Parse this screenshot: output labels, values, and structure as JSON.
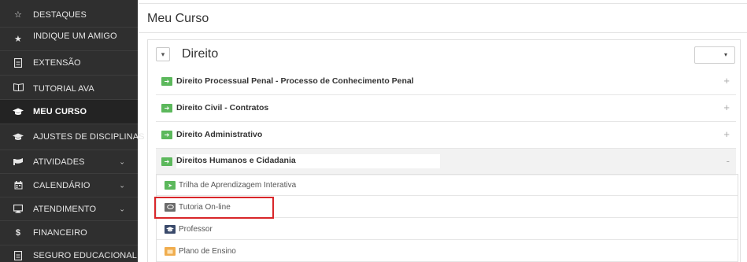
{
  "sidebar": {
    "items": [
      {
        "label": "DESTAQUES",
        "icon": "star-outline-icon"
      },
      {
        "label": "INDIQUE UM AMIGO",
        "icon": "star-icon"
      },
      {
        "label": "EXTENSÃO",
        "icon": "document-icon"
      },
      {
        "label": "TUTORIAL AVA",
        "icon": "book-icon"
      },
      {
        "label": "MEU CURSO",
        "icon": "graduation-cap-icon",
        "active": true
      },
      {
        "label": "AJUSTES DE DISCIPLINAS",
        "icon": "graduation-cap-icon"
      },
      {
        "label": "ATIVIDADES",
        "icon": "flag-icon",
        "chevron": "⌄"
      },
      {
        "label": "CALENDÁRIO",
        "icon": "calendar-icon",
        "chevron": "⌄"
      },
      {
        "label": "ATENDIMENTO",
        "icon": "monitor-icon",
        "chevron": "⌄"
      },
      {
        "label": "FINANCEIRO",
        "icon": "dollar-icon"
      },
      {
        "label": "SEGURO EDUCACIONAL",
        "icon": "document-icon"
      }
    ]
  },
  "main": {
    "title": "Meu Curso",
    "course": {
      "collapse_symbol": "▾",
      "name": "Direito",
      "select_caret": "▾"
    },
    "disciplines": [
      {
        "label": "Direito Processual Penal - Processo de Conhecimento Penal",
        "toggle": "+"
      },
      {
        "label": "Direito Civil - Contratos",
        "toggle": "+"
      },
      {
        "label": "Direito Administrativo",
        "toggle": "+"
      },
      {
        "label": "Direitos Humanos e Cidadania",
        "toggle": "-"
      }
    ],
    "resources": [
      {
        "label": "Trilha de Aprendizagem Interativa",
        "icon": "send-icon",
        "color": "#5cb85c"
      },
      {
        "label": "Tutoria On-line",
        "icon": "chat-icon",
        "color": "#6b6b6b"
      },
      {
        "label": "Professor",
        "icon": "graduation-cap-icon",
        "color": "#3a4a6b"
      },
      {
        "label": "Plano de Ensino",
        "icon": "document-icon",
        "color": "#f0ad4e"
      }
    ]
  },
  "colors": {
    "sidebar_bg": "#2f2f2f",
    "go_icon": "#5cb85c",
    "highlight": "#d9262a"
  }
}
